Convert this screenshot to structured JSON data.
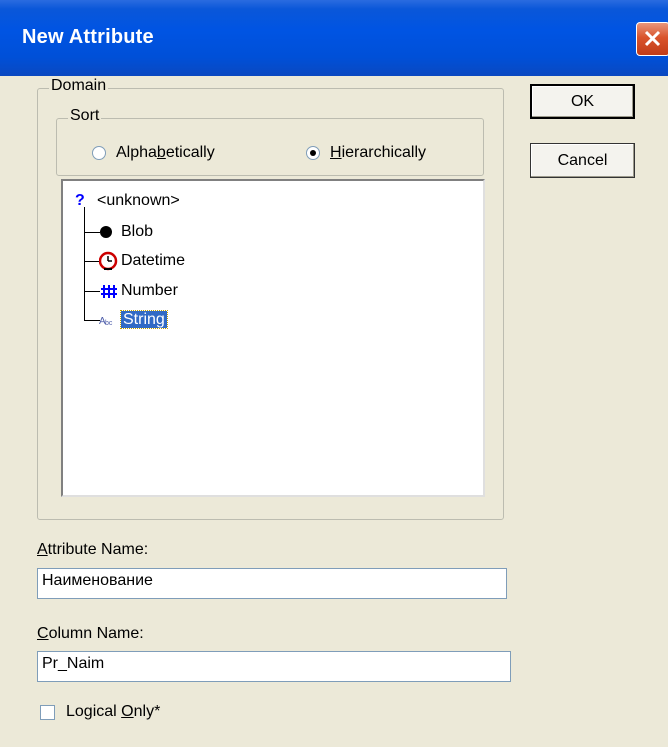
{
  "window": {
    "title": "New Attribute"
  },
  "domain_group": {
    "label": "Domain"
  },
  "sort_group": {
    "label": "Sort",
    "options": [
      {
        "pre": "Alpha",
        "accel": "b",
        "post": "etically",
        "checked": false
      },
      {
        "pre": "",
        "accel": "H",
        "post": "ierarchically",
        "checked": true
      }
    ]
  },
  "tree": {
    "items": [
      {
        "label": "<unknown>",
        "icon": "question-icon"
      },
      {
        "label": "Blob",
        "icon": "blob-dot-icon"
      },
      {
        "label": "Datetime",
        "icon": "clock-icon"
      },
      {
        "label": "Number",
        "icon": "number-hash-icon"
      },
      {
        "label": "String",
        "icon": "string-abc-icon",
        "selected": true
      }
    ]
  },
  "buttons": {
    "ok": "OK",
    "cancel": "Cancel"
  },
  "attribute_name": {
    "label_accel": "A",
    "label_rest": "ttribute Name:",
    "value": "Наименование"
  },
  "column_name": {
    "label_accel": "C",
    "label_rest": "olumn Name:",
    "value": "Pr_Naim"
  },
  "logical_only": {
    "pre": "Logical ",
    "accel": "O",
    "post": "nly*",
    "checked": false
  },
  "colors": {
    "titlebar": "#0054e3",
    "dialog_bg": "#ece9d8",
    "selection": "#316ac5",
    "close": "#d9542c"
  }
}
